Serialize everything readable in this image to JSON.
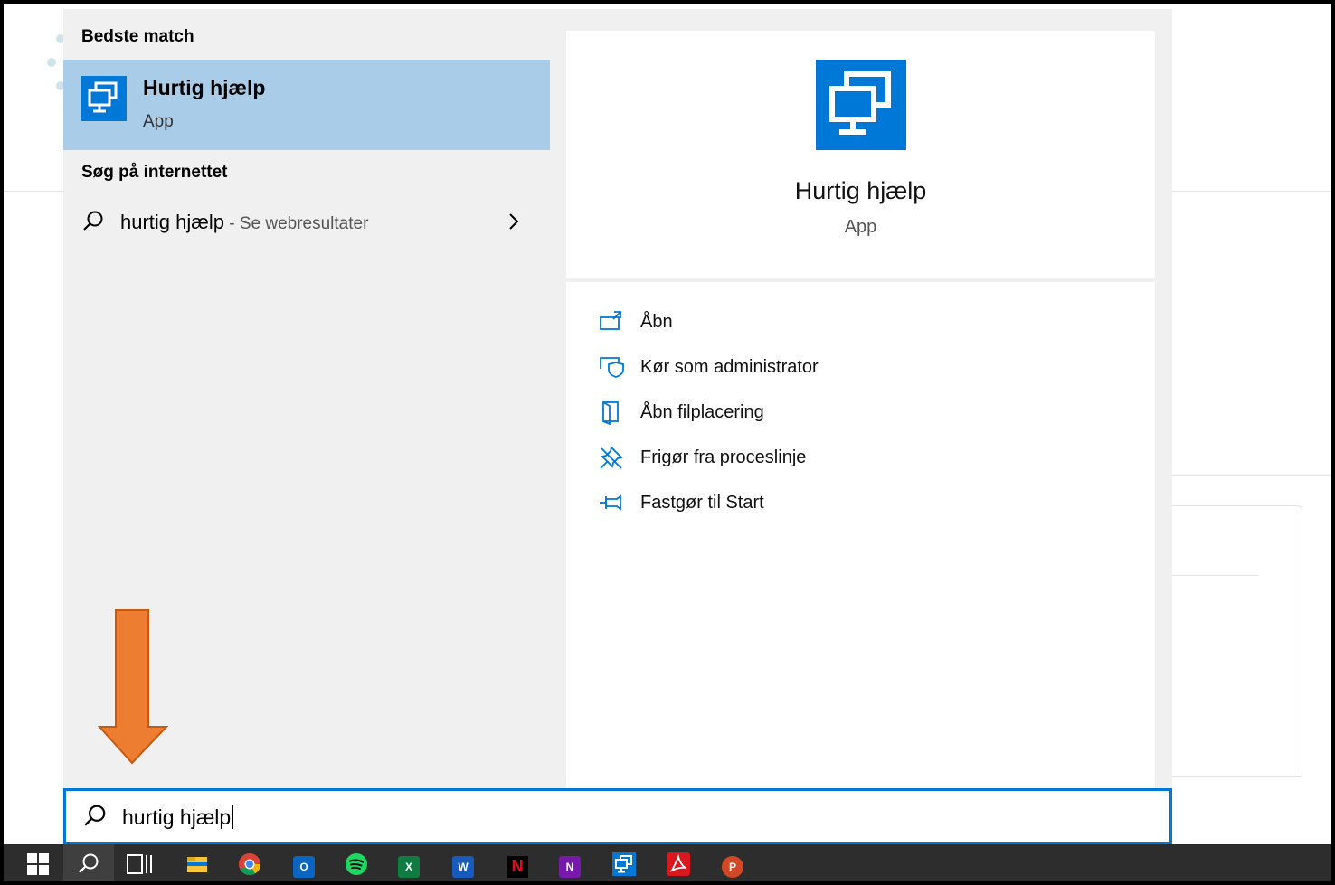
{
  "background": {
    "theme_accent": "#0078d7"
  },
  "left_pane": {
    "best_match_heading": "Bedste match",
    "best_match": {
      "name": "Hurtig hjælp",
      "type": "App",
      "icon": "remote-desktop-icon",
      "highlight_color": "#a9cde9"
    },
    "web_heading": "Søg på internettet",
    "web_result": {
      "query": "hurtig hjælp",
      "hint": " - Se webresultater",
      "icon": "search-icon",
      "chevron": "›"
    }
  },
  "detail_pane": {
    "app_name": "Hurtig hjælp",
    "app_type": "App",
    "icon": "remote-desktop-icon",
    "actions": [
      {
        "label": "Åbn",
        "icon": "open-icon"
      },
      {
        "label": "Kør som administrator",
        "icon": "run-as-admin-icon"
      },
      {
        "label": "Åbn filplacering",
        "icon": "file-location-icon"
      },
      {
        "label": "Frigør fra proceslinje",
        "icon": "unpin-taskbar-icon"
      },
      {
        "label": "Fastgør til Start",
        "icon": "pin-start-icon"
      }
    ]
  },
  "annotation": {
    "arrow_color": "#ed7d31"
  },
  "search_box": {
    "value": "hurtig hjælp",
    "icon": "search-icon"
  },
  "taskbar": {
    "items": [
      {
        "name": "start",
        "icon": "windows-icon",
        "active": false
      },
      {
        "name": "search",
        "icon": "search-icon",
        "active": false
      },
      {
        "name": "task-view",
        "icon": "task-view-icon",
        "active": false
      },
      {
        "name": "file-explorer",
        "icon": "folder-icon",
        "active": true
      },
      {
        "name": "chrome",
        "icon": "chrome-icon",
        "active": true
      },
      {
        "name": "outlook",
        "icon": "outlook-icon",
        "label": "O",
        "active": true
      },
      {
        "name": "spotify",
        "icon": "spotify-icon",
        "active": false
      },
      {
        "name": "excel",
        "icon": "excel-icon",
        "label": "X",
        "active": false
      },
      {
        "name": "word",
        "icon": "word-icon",
        "label": "W",
        "active": false
      },
      {
        "name": "netflix",
        "icon": "netflix-icon",
        "label": "N",
        "active": false
      },
      {
        "name": "onenote",
        "icon": "onenote-icon",
        "label": "N",
        "active": false
      },
      {
        "name": "quick-assist",
        "icon": "remote-desktop-icon",
        "active": true
      },
      {
        "name": "acrobat",
        "icon": "acrobat-icon",
        "active": false
      },
      {
        "name": "powerpoint",
        "icon": "powerpoint-icon",
        "label": "P",
        "active": true
      }
    ]
  }
}
